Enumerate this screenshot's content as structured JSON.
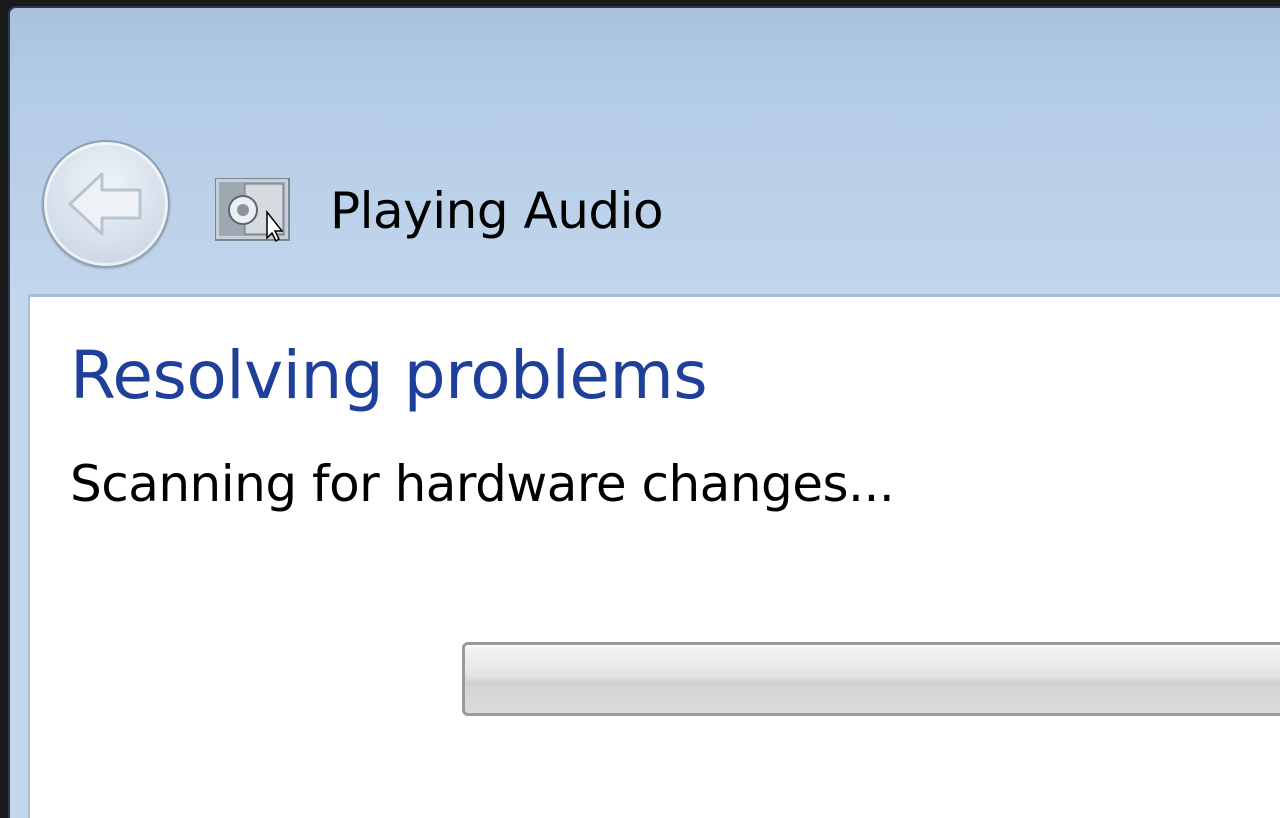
{
  "window": {
    "title": "Playing Audio",
    "app_icon": "audio-troubleshooter-icon",
    "back_icon": "back-arrow-icon"
  },
  "main": {
    "heading": "Resolving problems",
    "status": "Scanning for hardware changes...",
    "progress": 0
  },
  "colors": {
    "heading": "#1e3f9a",
    "titlebar": "#b4cbe6",
    "content_bg": "#ffffff"
  }
}
